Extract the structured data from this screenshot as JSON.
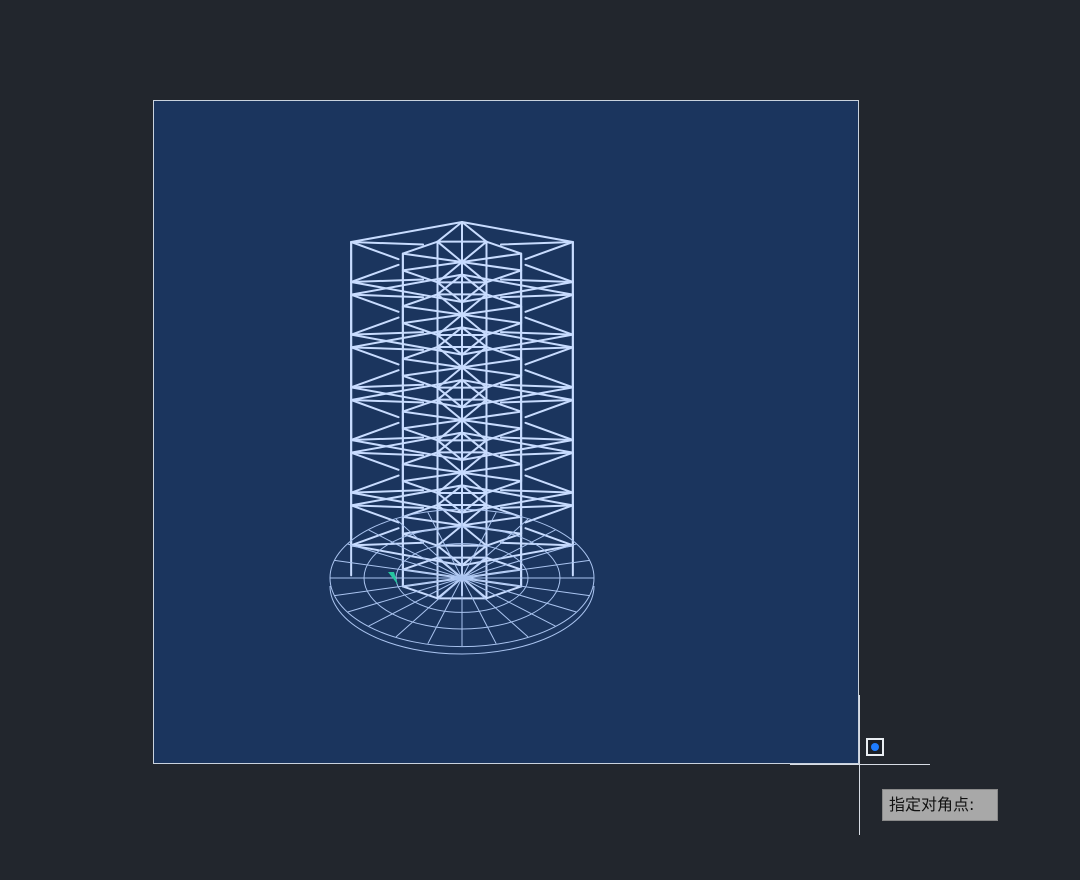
{
  "viewport": {
    "background_color": "#22262d",
    "selection_window_color": "#1b355e",
    "wireframe_color": "#c8dcff"
  },
  "cursor": {
    "prompt_text": "指定对角点:",
    "snap_marker_icon": "snap-point-icon",
    "snap_marker_color": "#1e7cff"
  },
  "model": {
    "icon": "wireframe-tower-model",
    "levels": 6
  }
}
